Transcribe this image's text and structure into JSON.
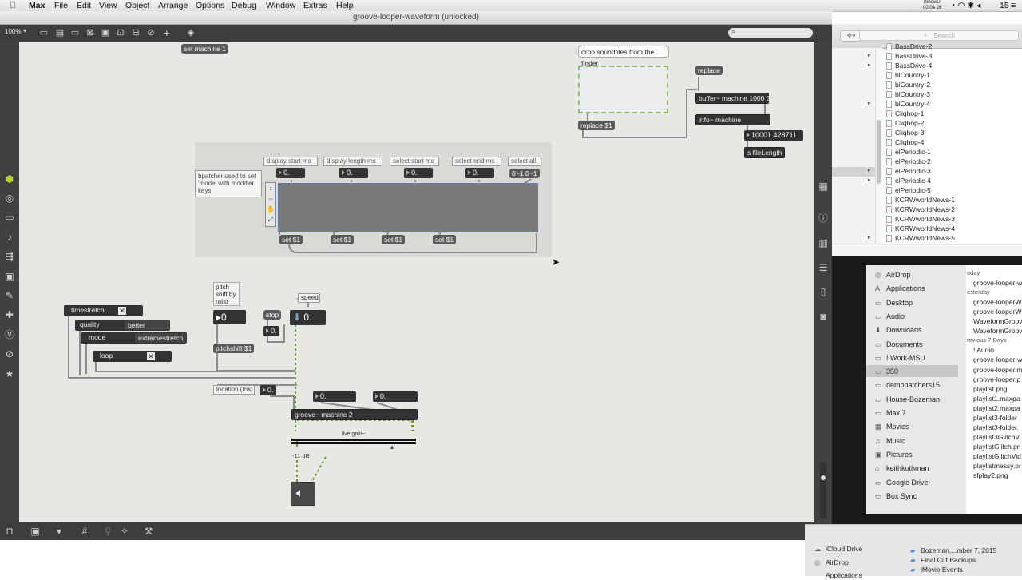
{
  "menubar": {
    "app": "Max",
    "items": [
      "File",
      "Edit",
      "View",
      "Object",
      "Arrange",
      "Options",
      "Debug",
      "Window",
      "Extras",
      "Help"
    ],
    "status_left": "iShowU",
    "status_time": "00:04:26",
    "status_num": "15"
  },
  "window": {
    "title": "groove-looper-waveform (unlocked)",
    "zoom": "100%"
  },
  "patch": {
    "set_machine": "set machine 1",
    "drop_comment": "drop soundfiles from the finder",
    "replace_msg": "replace",
    "replace_s1": "replace $1",
    "buffer_obj": "buffer~ machine 1000 2",
    "info_obj": "info~ machine",
    "file_length_num": "10001.428711",
    "s_file_length": "s fileLength",
    "bpatcher_comment": "bpatcher used to set 'mode' with modifier keys",
    "display_start": "display start ms",
    "display_length": "display length ms",
    "select_start": "select start ms",
    "select_end": "select end ms",
    "select_all": "select all",
    "num_zero": "0.",
    "select_all_msg": "0 -1 0 -1",
    "set_s1": "set $1",
    "timestretch": "timestretch",
    "quality": "quality",
    "quality_val": "better",
    "mode": "mode",
    "mode_val": "extremestretch",
    "loop": "loop",
    "pitch_comment": "pitch\nshift by\nratio",
    "stop": "stop",
    "speed": "speed",
    "pitchshift": "pitchshift $1",
    "location": "location (ms)",
    "groove": "groove~ machine 2",
    "livegain": "live.gain~",
    "gain_db": "-11 dB"
  },
  "finder_top": {
    "search_placeholder": "Search",
    "items": [
      {
        "name": "BassDrive-2",
        "arrow": false
      },
      {
        "name": "BassDrive-3",
        "arrow": true
      },
      {
        "name": "BassDrive-4",
        "arrow": true
      },
      {
        "name": "blCountry-1",
        "arrow": false
      },
      {
        "name": "blCountry-2",
        "arrow": false
      },
      {
        "name": "blCountry-3",
        "arrow": false
      },
      {
        "name": "blCountry-4",
        "arrow": true
      },
      {
        "name": "Cliqhop-1",
        "arrow": false
      },
      {
        "name": "Cliqhop-2",
        "arrow": false
      },
      {
        "name": "Cliqhop-3",
        "arrow": false
      },
      {
        "name": "Cliqhop-4",
        "arrow": false
      },
      {
        "name": "elPeriodic-1",
        "arrow": false
      },
      {
        "name": "elPeriodic-2",
        "arrow": false
      },
      {
        "name": "elPeriodic-3",
        "arrow": true
      },
      {
        "name": "elPeriodic-4",
        "arrow": true
      },
      {
        "name": "elPeriodic-5",
        "arrow": false
      },
      {
        "name": "KCRWworldNews-1",
        "arrow": false
      },
      {
        "name": "KCRWworldNews-2",
        "arrow": false
      },
      {
        "name": "KCRWworldNews-3",
        "arrow": false
      },
      {
        "name": "KCRWworldNews-4",
        "arrow": false
      },
      {
        "name": "KCRWworldNews-5",
        "arrow": true
      }
    ]
  },
  "finder_sidebar": {
    "items": [
      {
        "name": "AirDrop",
        "icon": "airdrop-icon",
        "glyph": "◎"
      },
      {
        "name": "Applications",
        "icon": "applications-icon",
        "glyph": "A"
      },
      {
        "name": "Desktop",
        "icon": "desktop-icon",
        "glyph": "▭"
      },
      {
        "name": "Audio",
        "icon": "folder-icon",
        "glyph": "▭"
      },
      {
        "name": "Downloads",
        "icon": "downloads-icon",
        "glyph": "⬇"
      },
      {
        "name": "Documents",
        "icon": "documents-icon",
        "glyph": "▭"
      },
      {
        "name": "! Work-MSU",
        "icon": "folder-icon",
        "glyph": "▭"
      },
      {
        "name": "350",
        "icon": "folder-icon",
        "glyph": "▭",
        "selected": true
      },
      {
        "name": "demopatchers15",
        "icon": "folder-icon",
        "glyph": "▭"
      },
      {
        "name": "House-Bozeman",
        "icon": "folder-icon",
        "glyph": "▭"
      },
      {
        "name": "Max 7",
        "icon": "folder-icon",
        "glyph": "▭"
      },
      {
        "name": "Movies",
        "icon": "movies-icon",
        "glyph": "▦"
      },
      {
        "name": "Music",
        "icon": "music-icon",
        "glyph": "♫"
      },
      {
        "name": "Pictures",
        "icon": "pictures-icon",
        "glyph": "▣"
      },
      {
        "name": "keithkothman",
        "icon": "home-icon",
        "glyph": "⌂"
      },
      {
        "name": "Google Drive",
        "icon": "folder-icon",
        "glyph": "▭"
      },
      {
        "name": "Box Sync",
        "icon": "folder-icon",
        "glyph": "▭"
      }
    ]
  },
  "finder_right": {
    "items": [
      "oday",
      "groove-looper-w",
      "esterday",
      "groove-looperW",
      "groove-looperW",
      "WaveformGroov",
      "WaveformGroov",
      "revious 7 Days",
      "! Audio",
      "groove-looper-w",
      "groove-looper.m",
      "groove-looper.p",
      "playlist.png",
      "playlist1.maxpa",
      "playlist2.maxpa",
      "playlist3-folder",
      "playlist3-folder.",
      "playlist3GlitchV",
      "playlistGlitch.pn",
      "playlistGlitchVid",
      "playlistmessy.pr",
      "sfplay2.png"
    ]
  },
  "finder_bottom": {
    "left": [
      "iCloud Drive",
      "AirDrop",
      "Applications"
    ],
    "right": [
      "Bozeman,...mber 7, 2015",
      "Final Cut Backups",
      "iMovie Events"
    ]
  },
  "colors": {
    "canvas": "#e7e7e3",
    "object": "#333333",
    "patchcord": "#8a8a8a",
    "signal": "#6f9a3a"
  }
}
